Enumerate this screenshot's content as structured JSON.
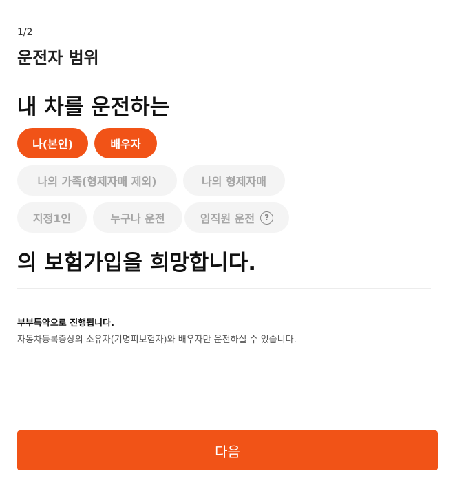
{
  "header": {
    "step": "1/2",
    "title": "운전자 범위"
  },
  "question": {
    "lead": "내 차를 운전하는",
    "tail": "의 보험가입을 희망합니다."
  },
  "options": {
    "self": {
      "label": "나(본인)",
      "selected": true
    },
    "spouse": {
      "label": "배우자",
      "selected": true
    },
    "family": {
      "label": "나의 가족(형제자매 제외)",
      "selected": false
    },
    "siblings": {
      "label": "나의 형제자매",
      "selected": false
    },
    "one_person": {
      "label": "지정1인",
      "selected": false
    },
    "anyone": {
      "label": "누구나 운전",
      "selected": false
    },
    "staff": {
      "label": "임직원 운전",
      "selected": false,
      "help_icon": "?"
    }
  },
  "note": {
    "title": "부부특약으로 진행됩니다.",
    "description": "자동차등록증상의 소유자(기명피보험자)와 배우자만 운전하실 수 있습니다."
  },
  "footer": {
    "next_label": "다음"
  },
  "colors": {
    "accent": "#f15317",
    "chip_off_bg": "#f4f4f4",
    "chip_off_text": "#a6a6a6"
  }
}
